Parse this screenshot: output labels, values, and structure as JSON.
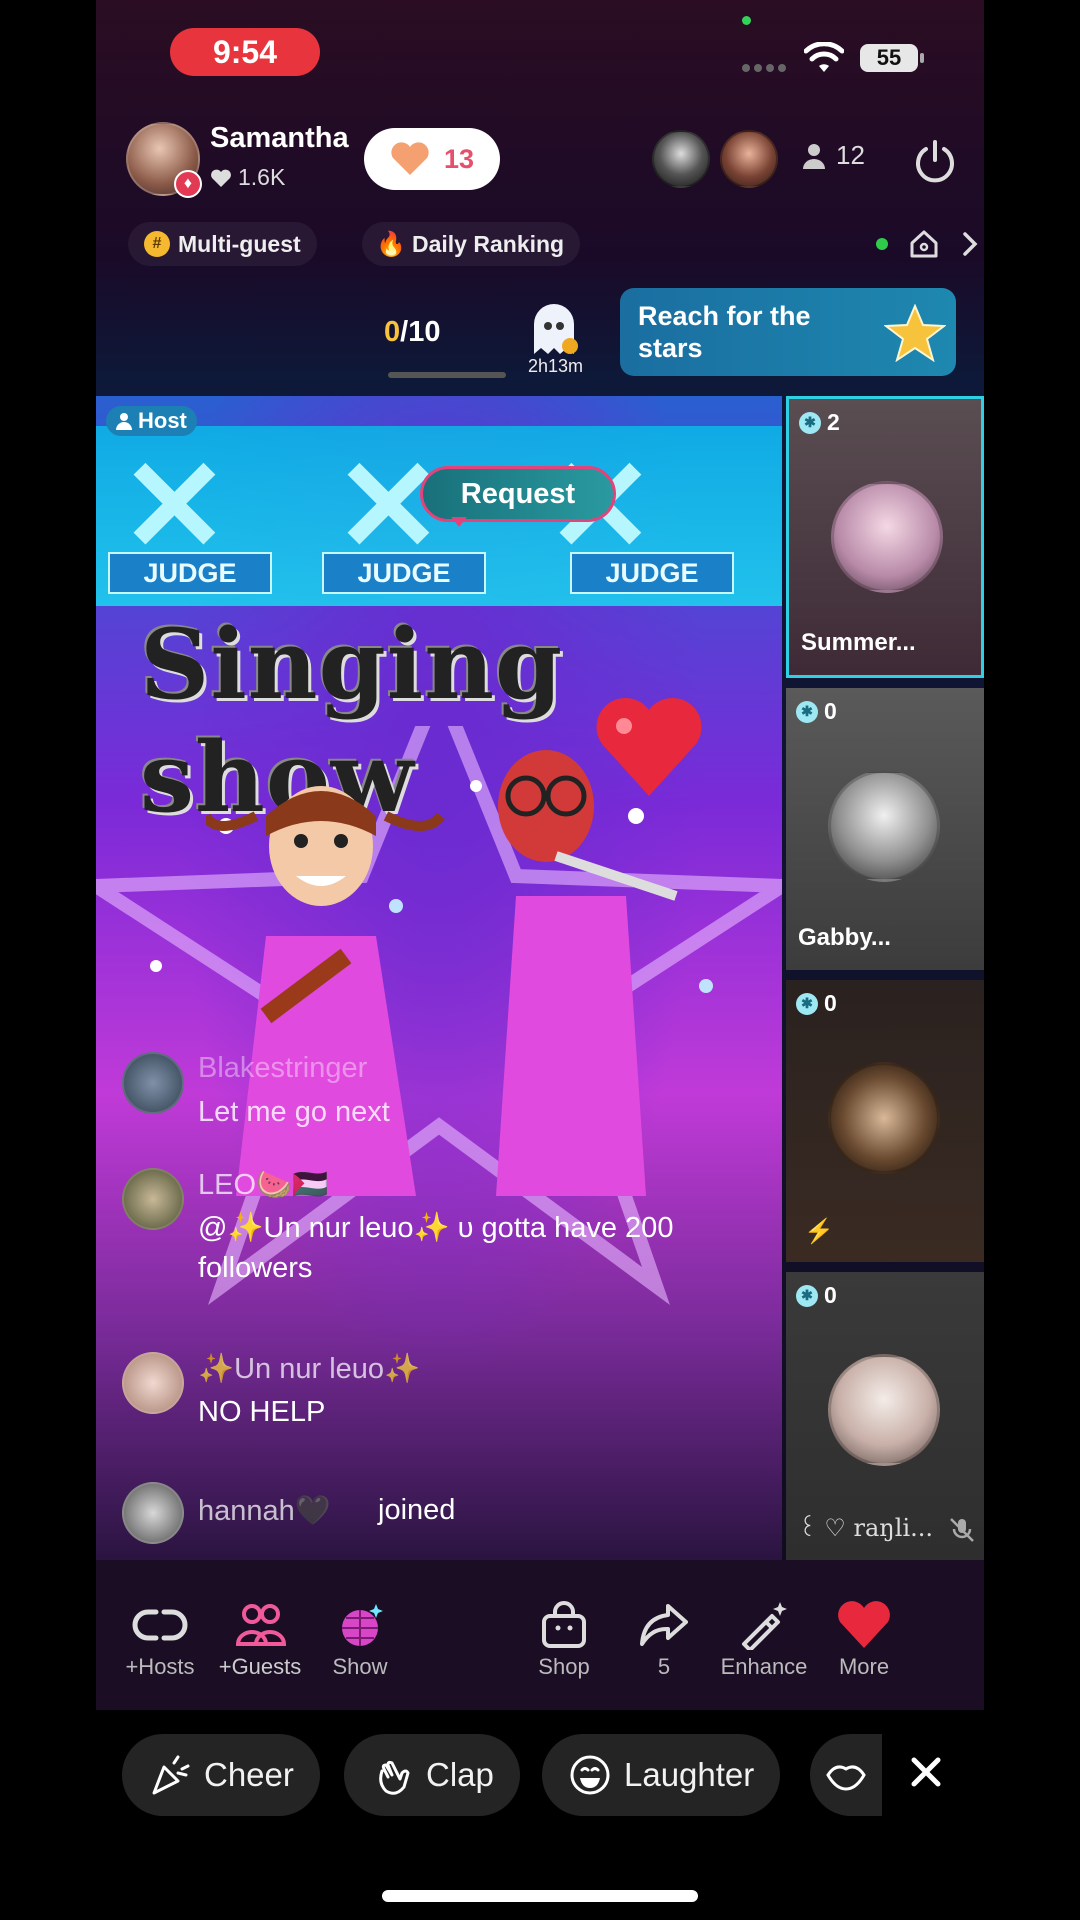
{
  "status_bar": {
    "time": "9:54",
    "battery": "55"
  },
  "host": {
    "name": "Samantha",
    "likes": "1.6K",
    "hearts": "13"
  },
  "viewers": {
    "count": "12"
  },
  "tags": {
    "multi_guest": "Multi-guest",
    "daily_ranking": "Daily Ranking"
  },
  "goal": {
    "current": "0",
    "total": "/10",
    "timer": "2h13m",
    "promo": "Reach for the stars"
  },
  "stage": {
    "host_chip": "Host",
    "request": "Request",
    "judge_labels": [
      "JUDGE",
      "JUDGE",
      "JUDGE"
    ],
    "title": "Singing show"
  },
  "chat": [
    {
      "name": "Blakestringer",
      "message": "Let me go next"
    },
    {
      "name": "LEO🍉🇵🇸",
      "message": "@✨Un nur leuo✨ ᴜ gotta have 200 followers"
    },
    {
      "name": "✨Un nur leuo✨",
      "message": "NO HELP"
    },
    {
      "name": "hannah🖤",
      "message": "joined"
    }
  ],
  "guests": [
    {
      "score": "2",
      "name": "Summer..."
    },
    {
      "score": "0",
      "name": "Gabby..."
    },
    {
      "score": "0",
      "name": ""
    },
    {
      "score": "0",
      "name": "꒰ ♡ raŋli..."
    }
  ],
  "toolbar": {
    "hosts": "+Hosts",
    "guests": "+Guests",
    "show": "Show",
    "shop": "Shop",
    "share": "5",
    "enhance": "Enhance",
    "more": "More"
  },
  "reactions": {
    "cheer": "Cheer",
    "clap": "Clap",
    "laughter": "Laughter"
  },
  "colors": {
    "accent_cyan": "#30d0e4",
    "time_pill": "#e8343c",
    "request_border": "#e2437a"
  }
}
